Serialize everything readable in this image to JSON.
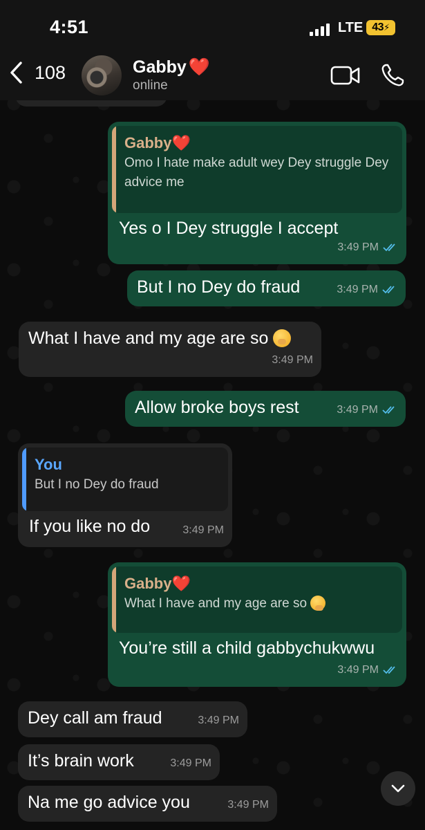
{
  "status_bar": {
    "time": "4:51",
    "network": "LTE",
    "battery": "43"
  },
  "header": {
    "back_count": "108",
    "contact_name": "Gabby",
    "contact_emoji": "❤️",
    "contact_status": "online",
    "icons": [
      "chevron-left-icon",
      "video-call-icon",
      "phone-icon"
    ]
  },
  "messages": [
    {
      "direction": "out",
      "quote": {
        "author": "Gabby",
        "author_emoji": "❤️",
        "text": "Omo I hate make adult wey Dey struggle Dey advice me"
      },
      "text": "Yes o I Dey struggle I accept",
      "time": "3:49 PM",
      "read": true
    },
    {
      "direction": "out",
      "text": "But I no Dey do fraud",
      "time": "3:49 PM",
      "read": true
    },
    {
      "direction": "in",
      "text": "What I have and my age are so",
      "emoji": "🫢",
      "time": "3:49 PM"
    },
    {
      "direction": "out",
      "text": "Allow broke boys rest",
      "time": "3:49 PM",
      "read": true
    },
    {
      "direction": "in",
      "quote": {
        "author": "You",
        "text": "But I no Dey do fraud"
      },
      "text": "If you like no do",
      "time": "3:49 PM"
    },
    {
      "direction": "out",
      "quote": {
        "author": "Gabby",
        "author_emoji": "❤️",
        "text": "What I have and my age are so",
        "text_emoji": "🫢"
      },
      "text": "You’re still a child gabbychukwwu",
      "time": "3:49 PM",
      "read": true
    },
    {
      "direction": "in",
      "text": "Dey call am fraud",
      "time": "3:49 PM"
    },
    {
      "direction": "in",
      "text": "It’s brain work",
      "time": "3:49 PM"
    },
    {
      "direction": "in",
      "text": "Na me go advice you",
      "time": "3:49 PM"
    }
  ],
  "colors": {
    "outgoing": "#144d37",
    "incoming": "#242424",
    "tick_blue": "#53bdeb",
    "quote_tan": "#d9b08a",
    "quote_blue": "#5aa7ff"
  }
}
